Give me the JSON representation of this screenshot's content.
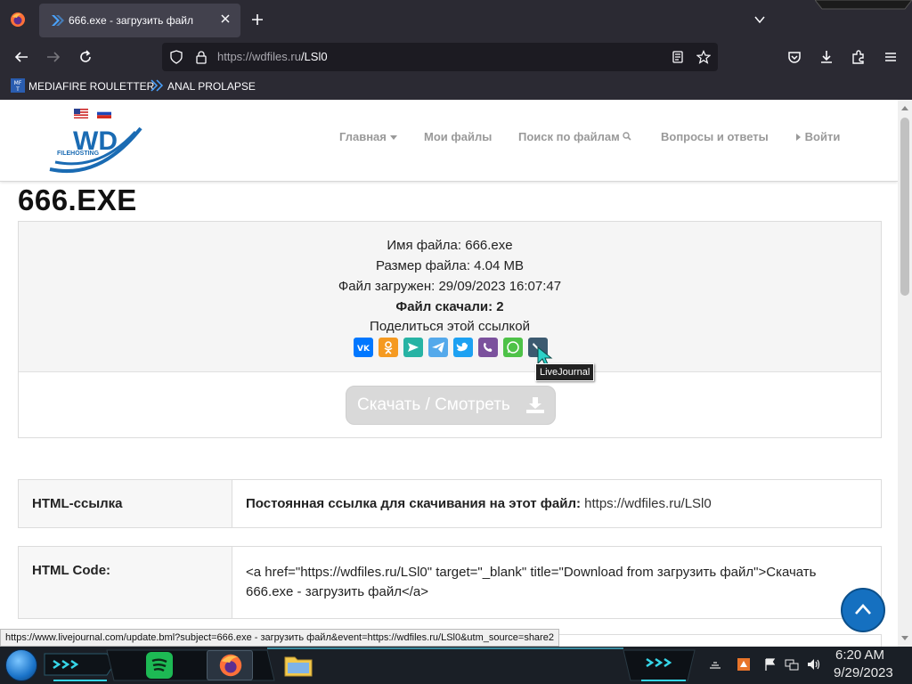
{
  "browser": {
    "tab_title": "666.exe - загрузить файл",
    "url_host": "https://wdfiles.ru",
    "url_path": "/LSl0",
    "bookmarks": [
      {
        "label": "MEDIAFIRE ROULETTER",
        "icon": "mediafire-icon"
      },
      {
        "label": "ANAL PROLAPSE",
        "icon": "bookmark-icon"
      }
    ]
  },
  "site": {
    "logo_text": "WD",
    "logo_sub": "FILEHOSTING",
    "menu": [
      {
        "label": "Главная",
        "icon": "caret-down-icon"
      },
      {
        "label": "Мои файлы"
      },
      {
        "label": "Поиск по файлам",
        "icon": "search-icon"
      },
      {
        "label": "Вопросы и ответы"
      },
      {
        "label": "Войти",
        "icon": "caret-right-icon"
      }
    ]
  },
  "file": {
    "title": "666.EXE",
    "name_line": "Имя файла: 666.exe",
    "size_line": "Размер файла: 4.04 MB",
    "uploaded_line": "Файл загружен: 29/09/2023 16:07:47",
    "downloads_line": "Файл скачали: 2",
    "share_label": "Поделиться этой ссылкой",
    "share_buttons": [
      {
        "name": "vk",
        "color": "#0077ff"
      },
      {
        "name": "odnoklassniki",
        "color": "#f59a21"
      },
      {
        "name": "yandex-messenger",
        "color": "#27b3a4"
      },
      {
        "name": "telegram",
        "color": "#54a9eb"
      },
      {
        "name": "twitter",
        "color": "#1da1f2"
      },
      {
        "name": "viber",
        "color": "#7b519d"
      },
      {
        "name": "whatsapp",
        "color": "#4ec248"
      },
      {
        "name": "livejournal",
        "color": "#3c5a70"
      }
    ],
    "download_label": "Скачать / Смотреть"
  },
  "tooltip": "LiveJournal",
  "rows": [
    {
      "label": "HTML-ссылка",
      "value_bold": "Постоянная ссылка для скачивания на этот файл:",
      "value_plain": "https://wdfiles.ru/LSl0"
    },
    {
      "label": "HTML Code:",
      "value_line1": "<a href=\"https://wdfiles.ru/LSl0\" target=\"_blank\" title=\"Download from загрузить файл\">Скачать",
      "value_line2": "666.exe - загрузить файл</a>"
    }
  ],
  "status_url": "https://www.livejournal.com/update.bml?subject=666.exe - загрузить файл&event=https://wdfiles.ru/LSl0&utm_source=share2",
  "clock": {
    "time": "6:20 AM",
    "date": "9/29/2023"
  },
  "colors": {
    "accent": "#1570c0",
    "header_border": "#d8d8d8"
  }
}
